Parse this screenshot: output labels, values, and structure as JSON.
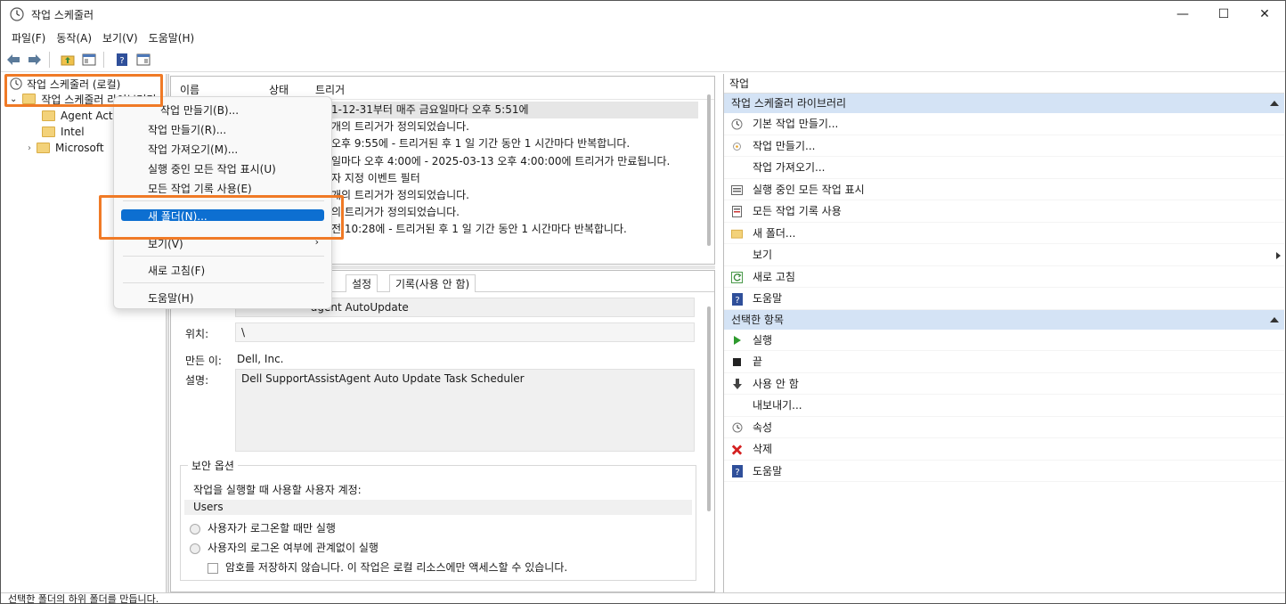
{
  "window": {
    "title": "작업 스케줄러",
    "minimize_glyph": "—",
    "maximize_glyph": "☐",
    "close_glyph": "✕"
  },
  "menu": [
    "파일(F)",
    "동작(A)",
    "보기(V)",
    "도움말(H)"
  ],
  "tree": {
    "root": "작업 스케줄러 (로컬)",
    "library": "작업 스케줄러 라이브러리",
    "children": [
      "Agent Acti",
      "Intel",
      "Microsoft"
    ]
  },
  "task_list": {
    "headers": [
      "이름",
      "상태",
      "트리거"
    ],
    "rows": [
      "1-12-31부터 매주 금요일마다 오후 5:51에",
      "개의 트리거가 정의되었습니다.",
      "오후 9:55에 - 트리거된 후 1 일 기간 동안 1 시간마다 반복합니다.",
      "일마다 오후 4:00에 - 2025-03-13 오후 4:00:00에 트리거가 만료됩니다.",
      "자 지정 이벤트 필터",
      "개의 트리거가 정의되었습니다.",
      "의 트리거가 정의되었습니다.",
      "전 10:28에 - 트리거된 후 1 일 기간 동안 1 시간마다 반복합니다."
    ],
    "selected_index": 0
  },
  "context_menu": {
    "items": [
      "작업 만들기(B)...",
      "작업 만들기(R)...",
      "작업 가져오기(M)...",
      "실행 중인 모든 작업 표시(U)",
      "모든 작업 기록 사용(E)",
      "새 폴더(N)...",
      "보기(V)",
      "새로 고침(F)",
      "도움말(H)"
    ],
    "highlighted": "새 폴더(N)..."
  },
  "details": {
    "tabs": [
      "설정",
      "기록(사용 안 함)"
    ],
    "name_value": "agent AutoUpdate",
    "location_label": "위치:",
    "location_value": "\\",
    "author_label": "만든 이:",
    "author_value": "Dell, Inc.",
    "description_label": "설명:",
    "description_value": "Dell SupportAssistAgent Auto Update Task Scheduler",
    "security": {
      "title": "보안 옵션",
      "account_label": "작업을 실행할 때 사용할 사용자 계정:",
      "account_value": "Users",
      "radio_logged_on": "사용자가 로그온할 때만 실행",
      "radio_whether": "사용자의 로그온 여부에 관계없이 실행",
      "checkbox_password": "암호를 저장하지 않습니다. 이 작업은 로컬 리소스에만 액세스할 수 있습니다."
    }
  },
  "actions": {
    "title": "작업",
    "library_section": "작업 스케줄러 라이브러리",
    "library_items": [
      {
        "label": "기본 작업 만들기...",
        "icon": "basic-task-icon"
      },
      {
        "label": "작업 만들기...",
        "icon": "create-task-icon"
      },
      {
        "label": "작업 가져오기...",
        "icon": ""
      },
      {
        "label": "실행 중인 모든 작업 표시",
        "icon": "running-tasks-icon"
      },
      {
        "label": "모든 작업 기록 사용",
        "icon": "history-icon"
      },
      {
        "label": "새 폴더...",
        "icon": "folder-icon"
      },
      {
        "label": "보기",
        "icon": ""
      },
      {
        "label": "새로 고침",
        "icon": "refresh-icon"
      },
      {
        "label": "도움말",
        "icon": "help-icon"
      }
    ],
    "selected_section": "선택한 항목",
    "selected_items": [
      {
        "label": "실행",
        "icon": "run-icon"
      },
      {
        "label": "끝",
        "icon": "stop-icon"
      },
      {
        "label": "사용 안 함",
        "icon": "disable-icon"
      },
      {
        "label": "내보내기...",
        "icon": ""
      },
      {
        "label": "속성",
        "icon": "properties-icon"
      },
      {
        "label": "삭제",
        "icon": "delete-icon"
      },
      {
        "label": "도움말",
        "icon": "help-icon"
      }
    ]
  },
  "status": "선택한 폴더의 하위 폴더를 만듭니다."
}
